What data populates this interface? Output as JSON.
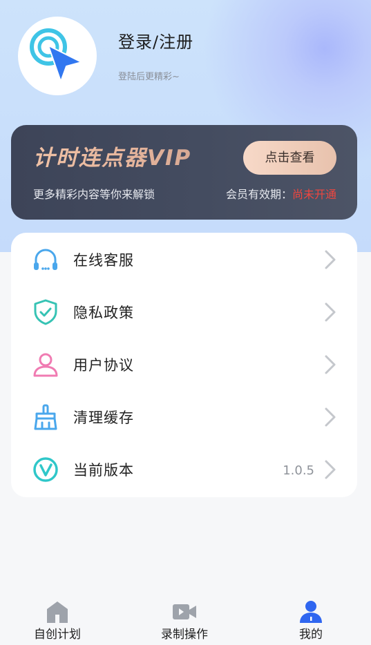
{
  "profile": {
    "title": "登录/注册",
    "subtitle": "登陆后更精彩~",
    "avatar_icon": "cursor-tap-icon"
  },
  "vip": {
    "title": "计时连点器VIP",
    "button_label": "点击查看",
    "description": "更多精彩内容等你来解锁",
    "expire_label": "会员有效期：",
    "expire_status": "尚未开通",
    "status_color": "#f0463f"
  },
  "menu": {
    "items": [
      {
        "label": "在线客服",
        "icon": "headset-icon",
        "value": ""
      },
      {
        "label": "隐私政策",
        "icon": "shield-check-icon",
        "value": ""
      },
      {
        "label": "用户协议",
        "icon": "user-icon",
        "value": ""
      },
      {
        "label": "清理缓存",
        "icon": "broom-icon",
        "value": ""
      },
      {
        "label": "当前版本",
        "icon": "version-v-icon",
        "value": "1.0.5"
      }
    ]
  },
  "tabs": [
    {
      "label": "自创计划",
      "icon": "home-icon",
      "active": false
    },
    {
      "label": "录制操作",
      "icon": "video-icon",
      "active": false
    },
    {
      "label": "我的",
      "icon": "profile-icon",
      "active": true
    }
  ],
  "colors": {
    "accent": "#2f66f0",
    "inactive_icon": "#9ea3ab"
  }
}
